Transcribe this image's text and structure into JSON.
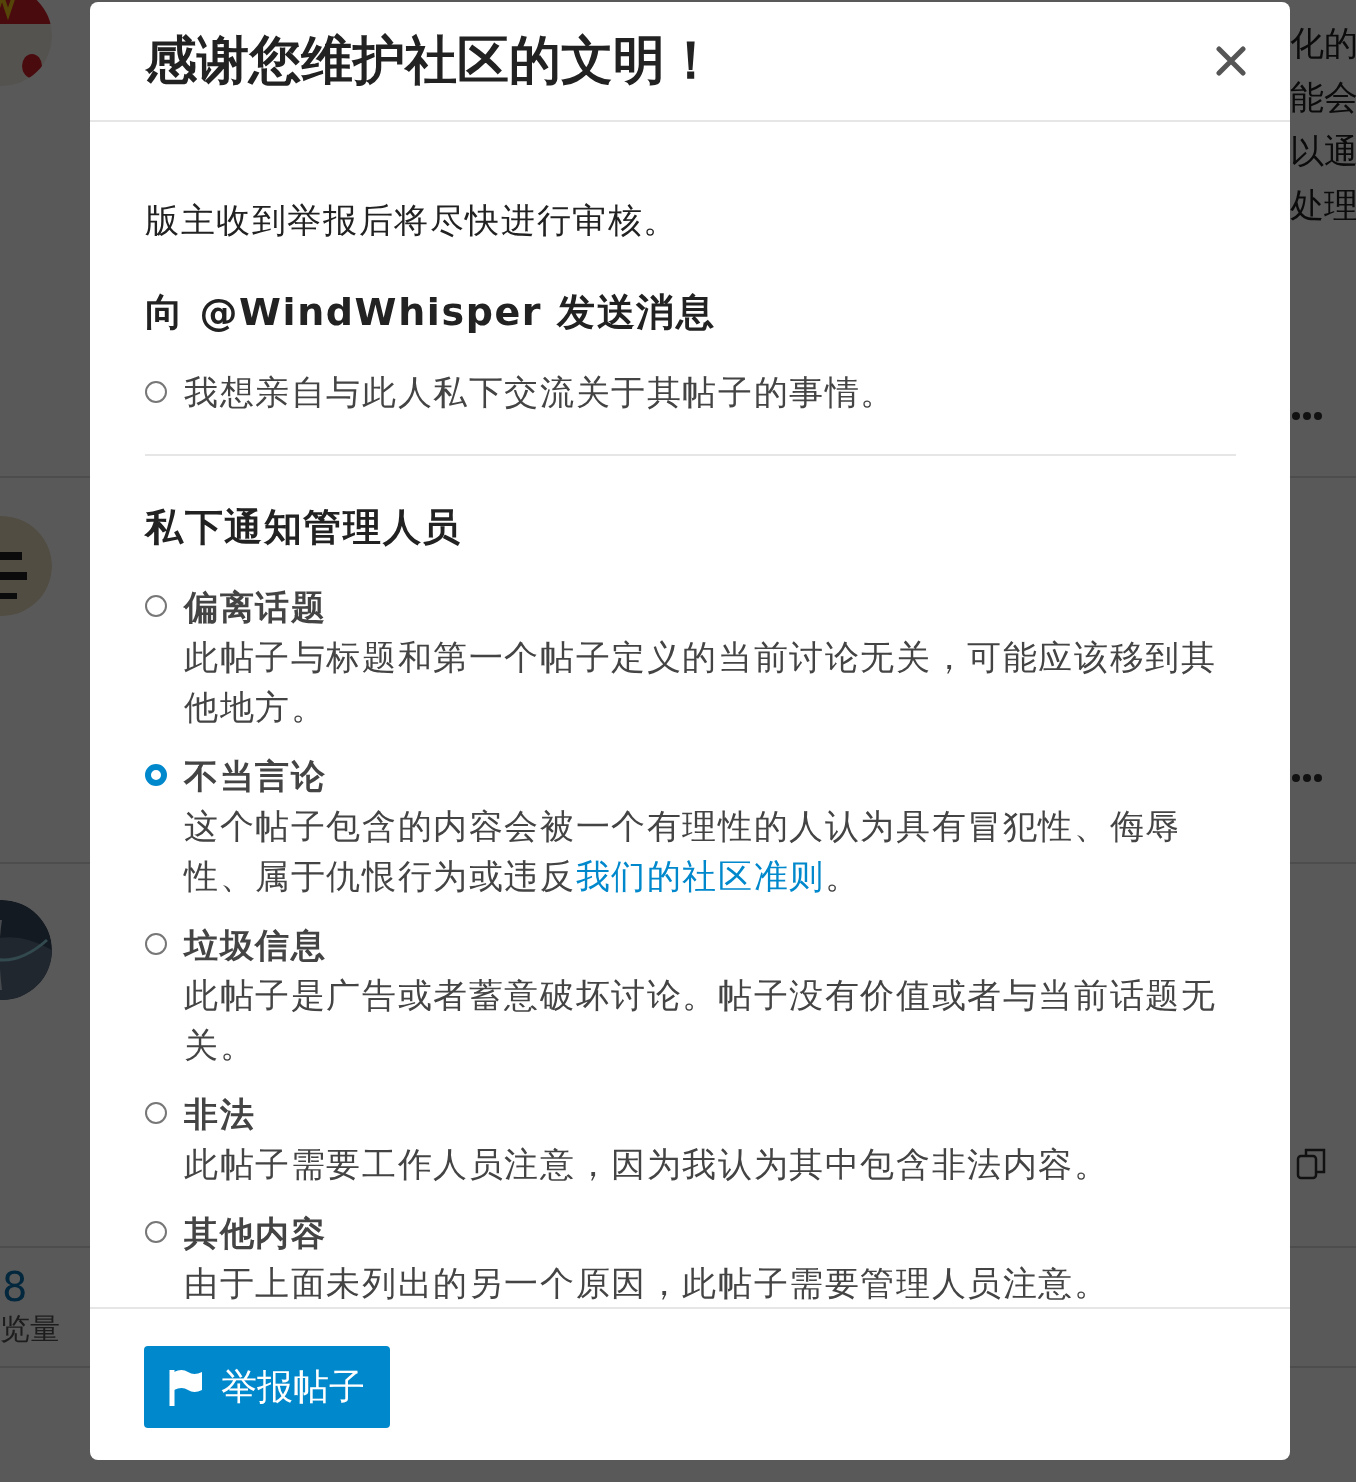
{
  "background": {
    "posts": [
      {
        "side_text": [
          "化的",
          "能会",
          "以通",
          "处理"
        ],
        "kind": "more"
      },
      {
        "kind": "more"
      },
      {
        "kind": "copy"
      }
    ],
    "stats": [
      {
        "value": "8",
        "label": "览量"
      }
    ]
  },
  "dialog": {
    "title": "感谢您维护社区的文明！",
    "intro": "版主收到举报后将尽快进行审核。",
    "message_section": {
      "heading": "向 @WindWhisper 发送消息",
      "options": [
        {
          "label": "我想亲自与此人私下交流关于其帖子的事情。",
          "selected": false
        }
      ]
    },
    "notify_section": {
      "heading": "私下通知管理人员",
      "options": [
        {
          "title": "偏离话题",
          "description": [
            {
              "text": "此帖子与标题和第一个帖子定义的当前讨论无关，可能应该移到其他地方。"
            }
          ],
          "selected": false
        },
        {
          "title": "不当言论",
          "description": [
            {
              "text": "这个帖子包含的内容会被一个有理性的人认为具有冒犯性、侮辱性、属于仇恨行为或违反"
            },
            {
              "text": "我们的社区准则",
              "kind": "link"
            },
            {
              "text": "。"
            }
          ],
          "selected": true
        },
        {
          "title": "垃圾信息",
          "description": [
            {
              "text": "此帖子是广告或者蓄意破坏讨论。帖子没有价值或者与当前话题无关。"
            }
          ],
          "selected": false
        },
        {
          "title": "非法",
          "description": [
            {
              "text": "此帖子需要工作人员注意，因为我认为其中包含非法内容。"
            }
          ],
          "selected": false
        },
        {
          "title": "其他内容",
          "description": [
            {
              "text": "由于上面未列出的另一个原因，此帖子需要管理人员注意。"
            }
          ],
          "selected": false
        }
      ]
    },
    "submit_button": {
      "label": "举报帖子"
    }
  }
}
